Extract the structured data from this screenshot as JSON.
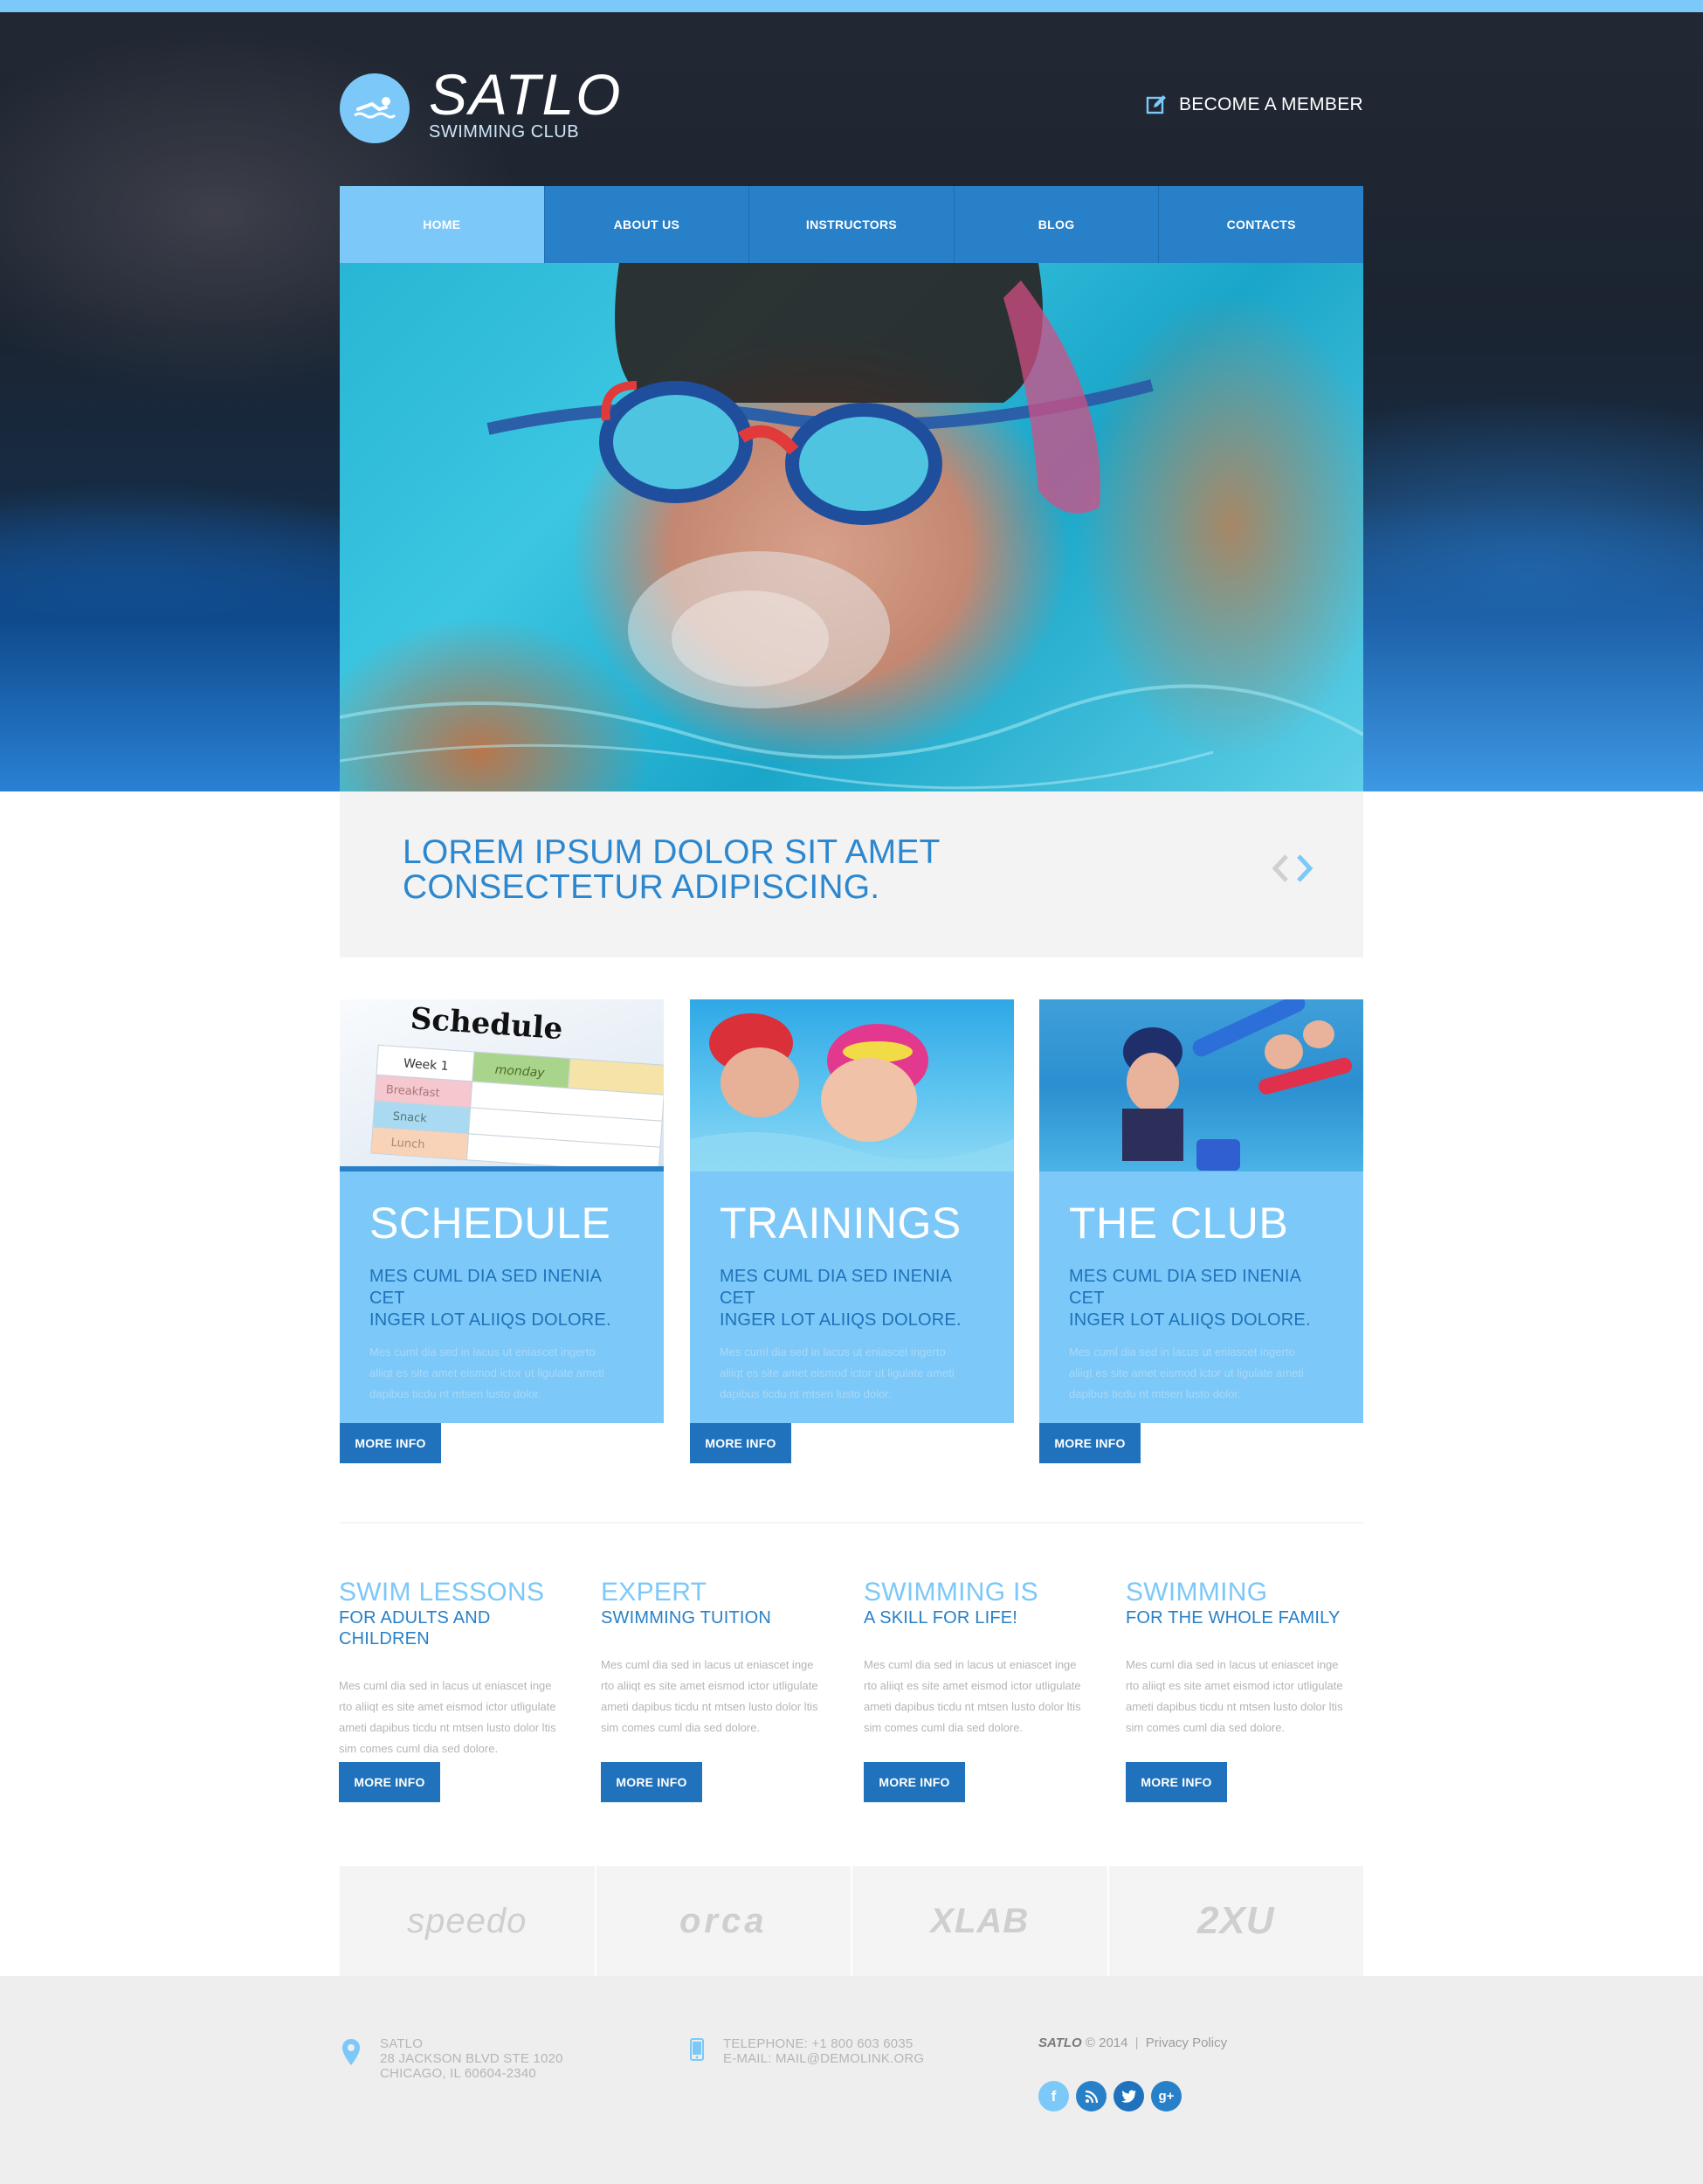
{
  "brand": {
    "title": "SATLO",
    "subtitle": "SWIMMING CLUB",
    "logo_icon": "swimmer-icon"
  },
  "header": {
    "become_member": "BECOME A MEMBER",
    "become_member_icon": "edit-icon"
  },
  "nav": {
    "items": [
      {
        "label": "HOME",
        "active": true
      },
      {
        "label": "ABOUT US",
        "active": false
      },
      {
        "label": "INSTRUCTORS",
        "active": false
      },
      {
        "label": "BLOG",
        "active": false
      },
      {
        "label": "CONTACTS",
        "active": false
      }
    ]
  },
  "slider": {
    "line1": "LOREM IPSUM DOLOR SIT AMET",
    "line2": "CONSECTETUR ADIPISCING.",
    "prev_icon": "chevron-left-icon",
    "next_icon": "chevron-right-icon"
  },
  "boxes": [
    {
      "title": "SCHEDULE",
      "sub1": "MES CUML DIA SED INENIA CET",
      "sub2": "INGER LOT ALIIQS DOLORE.",
      "text1": "Mes cuml dia sed in lacus ut eniascet ingerto",
      "text2": "aliiqt es site amet eismod ictor ut ligulate ameti",
      "text3": "dapibus ticdu nt mtsen lusto dolor.",
      "button": "MORE INFO",
      "image_text": "Schedule",
      "image_rows": [
        "Week 1",
        "monday",
        "Breakfast",
        "Snack",
        "Lunch"
      ]
    },
    {
      "title": "TRAININGS",
      "sub1": "MES CUML DIA SED INENIA CET",
      "sub2": "INGER LOT ALIIQS DOLORE.",
      "text1": "Mes cuml dia sed in lacus ut eniascet ingerto",
      "text2": "aliiqt es site amet eismod ictor ut ligulate ameti",
      "text3": "dapibus ticdu nt mtsen lusto dolor.",
      "button": "MORE INFO"
    },
    {
      "title": "THE CLUB",
      "sub1": "MES CUML DIA SED INENIA CET",
      "sub2": "INGER LOT ALIIQS DOLORE.",
      "text1": "Mes cuml dia sed in lacus ut eniascet ingerto",
      "text2": "aliiqt es site amet eismod ictor ut ligulate ameti",
      "text3": "dapibus ticdu nt mtsen lusto dolor.",
      "button": "MORE INFO"
    }
  ],
  "columns": [
    {
      "title": "SWIM LESSONS",
      "sub": "FOR ADULTS AND CHILDREN",
      "text1": "Mes cuml dia sed in lacus ut eniascet inge",
      "text2": "rto aliiqt es site amet eismod ictor utligulate",
      "text3": "ameti dapibus ticdu nt mtsen lusto dolor ltis",
      "text4": "sim comes cuml dia sed dolore.",
      "button": "MORE INFO"
    },
    {
      "title": "EXPERT",
      "sub": "SWIMMING TUITION",
      "text1": "Mes cuml dia sed in lacus ut eniascet inge",
      "text2": "rto aliiqt es site amet eismod ictor utligulate",
      "text3": "ameti dapibus ticdu nt mtsen lusto dolor ltis",
      "text4": "sim comes cuml dia sed dolore.",
      "button": "MORE INFO"
    },
    {
      "title": "SWIMMING IS",
      "sub": "A SKILL FOR LIFE!",
      "text1": "Mes cuml dia sed in lacus ut eniascet inge",
      "text2": "rto aliiqt es site amet eismod ictor utligulate",
      "text3": "ameti dapibus ticdu nt mtsen lusto dolor ltis",
      "text4": "sim comes cuml dia sed dolore.",
      "button": "MORE INFO"
    },
    {
      "title": "SWIMMING",
      "sub": "FOR THE WHOLE FAMILY",
      "text1": "Mes cuml dia sed in lacus ut eniascet inge",
      "text2": "rto aliiqt es site amet eismod ictor utligulate",
      "text3": "ameti dapibus ticdu nt mtsen lusto dolor ltis",
      "text4": "sim comes cuml dia sed dolore.",
      "button": "MORE INFO"
    }
  ],
  "brands": [
    "speedo",
    "orca",
    "XLAB",
    "2XU"
  ],
  "footer": {
    "address": {
      "icon": "map-pin-icon",
      "line1": "SATLO",
      "line2": "28 JACKSON BLVD STE 1020",
      "line3": "CHICAGO, IL 60604-2340"
    },
    "contact": {
      "icon": "phone-icon",
      "phone": "TELEPHONE: +1 800 603 6035",
      "email": "E-MAIL: MAIL@DEMOLINK.ORG"
    },
    "copyright": {
      "brand": "SATLO",
      "year": "© 2014",
      "separator": "|",
      "privacy": "Privacy Policy"
    },
    "socials": [
      {
        "name": "facebook-icon",
        "glyph": "f",
        "color": "#7cc8f8"
      },
      {
        "name": "rss-icon",
        "glyph": "",
        "color": "#2880c8"
      },
      {
        "name": "twitter-icon",
        "glyph": "",
        "color": "#1f72bb"
      },
      {
        "name": "google-plus-icon",
        "glyph": "g+",
        "color": "#2880c8"
      }
    ]
  },
  "colors": {
    "accent_light": "#7cc8f8",
    "accent": "#2880c8",
    "accent_dark": "#1f72bb",
    "panel_gray": "#f3f3f3",
    "footer_gray": "#eeeeee"
  }
}
